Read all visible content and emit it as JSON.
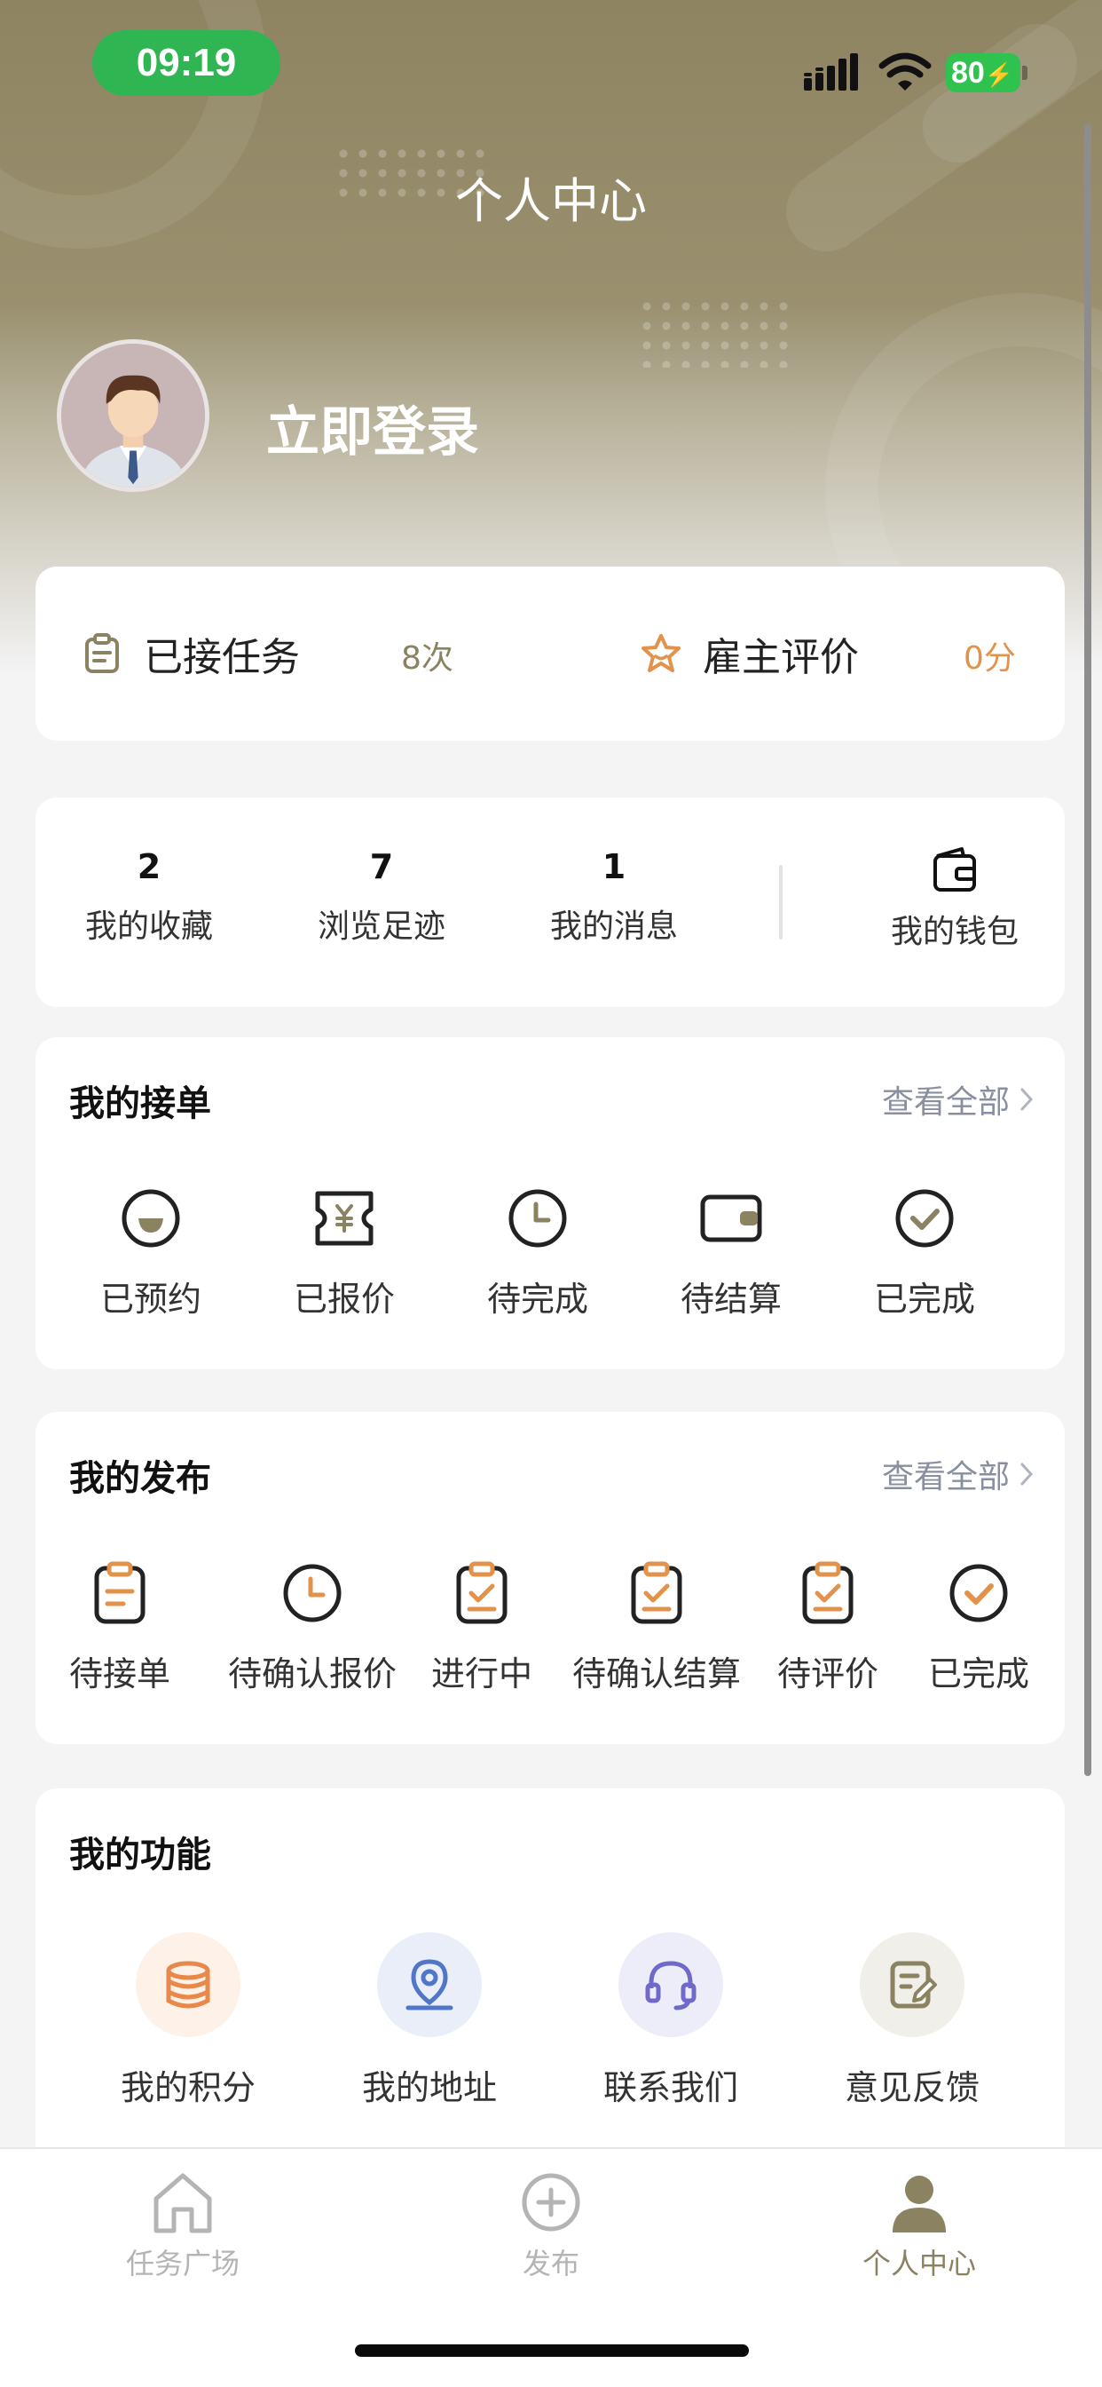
{
  "status_bar": {
    "time": "09:19",
    "battery": "80"
  },
  "header": {
    "title": "个人中心",
    "login_text": "立即登录"
  },
  "stats": [
    {
      "label": "已接任务",
      "value": "8次",
      "icon": "clipboard-icon",
      "color": "#8b8262"
    },
    {
      "label": "雇主评价",
      "value": "0分",
      "icon": "star-icon",
      "color": "#e2924a"
    }
  ],
  "counts": [
    {
      "num": "2",
      "label": "我的收藏"
    },
    {
      "num": "7",
      "label": "浏览足迹"
    },
    {
      "num": "1",
      "label": "我的消息"
    }
  ],
  "wallet": {
    "label": "我的钱包",
    "icon": "wallet-icon"
  },
  "orders": {
    "title": "我的接单",
    "view_all": "查看全部",
    "items": [
      {
        "label": "已预约",
        "icon": "appointment-icon"
      },
      {
        "label": "已报价",
        "icon": "quote-ticket-icon"
      },
      {
        "label": "待完成",
        "icon": "clock-icon"
      },
      {
        "label": "待结算",
        "icon": "wallet-icon"
      },
      {
        "label": "已完成",
        "icon": "check-circle-icon"
      }
    ]
  },
  "publish": {
    "title": "我的发布",
    "view_all": "查看全部",
    "items": [
      {
        "label": "待接单",
        "icon": "clipboard-list-icon"
      },
      {
        "label": "待确认报价",
        "icon": "clock-icon"
      },
      {
        "label": "进行中",
        "icon": "clipboard-check-icon"
      },
      {
        "label": "待确认结算",
        "icon": "clipboard-check-icon"
      },
      {
        "label": "待评价",
        "icon": "clipboard-check-icon"
      },
      {
        "label": "已完成",
        "icon": "check-circle-icon"
      }
    ]
  },
  "functions": {
    "title": "我的功能",
    "items": [
      {
        "label": "我的积分",
        "icon": "coins-icon",
        "color": "#e8884a",
        "bg": "#fdf1e8"
      },
      {
        "label": "我的地址",
        "icon": "location-icon",
        "color": "#4f76c9",
        "bg": "#e9eef8"
      },
      {
        "label": "联系我们",
        "icon": "headset-icon",
        "color": "#6f6ac9",
        "bg": "#ededf9"
      },
      {
        "label": "意见反馈",
        "icon": "feedback-icon",
        "color": "#8b8262",
        "bg": "#f1efe9"
      }
    ]
  },
  "tabbar": {
    "items": [
      {
        "label": "任务广场",
        "icon": "home-icon"
      },
      {
        "label": "发布",
        "icon": "plus-circle-icon"
      },
      {
        "label": "个人中心",
        "icon": "user-icon"
      }
    ]
  },
  "colors": {
    "accent": "#8b8262",
    "orange": "#e2924a",
    "status_green": "#2fb552"
  }
}
